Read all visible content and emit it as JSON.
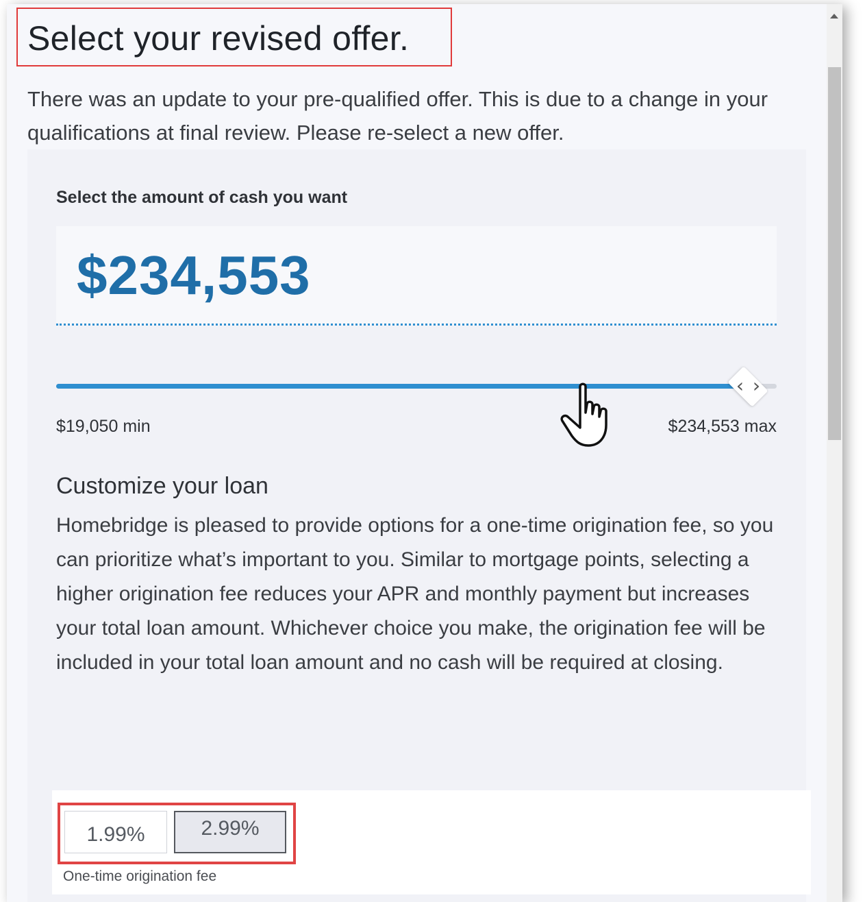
{
  "dialog": {
    "title": "Select your revised offer.",
    "intro": "There was an update to your pre-qualified offer. This is due to a change in your qualifications at final review. Please re-select a new offer."
  },
  "cash": {
    "label": "Select the amount of cash you want",
    "amount": "$234,553",
    "min_label": "$19,050 min",
    "max_label": "$234,553 max",
    "slider_value_fraction": 0.96
  },
  "customize": {
    "title": "Customize your loan",
    "text": "Homebridge is pleased to provide options for a one-time origination fee, so you can prioritize what’s important to you. Similar to mortgage points, selecting a higher origination fee reduces your APR and monthly payment but increases your total loan amount. Whichever choice you make, the origination fee will be included in your total loan amount and no cash will be required at closing."
  },
  "fee": {
    "options": [
      "1.99%",
      "2.99%"
    ],
    "selected": "2.99%",
    "caption": "One-time origination fee"
  },
  "colors": {
    "accent": "#2f8fd0",
    "amount": "#1f6ea8",
    "highlight": "#e04444"
  },
  "icons": {
    "scroll_up": "scroll-up-arrow-icon",
    "slider_handle": "chevron-left-right-icon",
    "cursor": "hand-pointer-icon"
  }
}
